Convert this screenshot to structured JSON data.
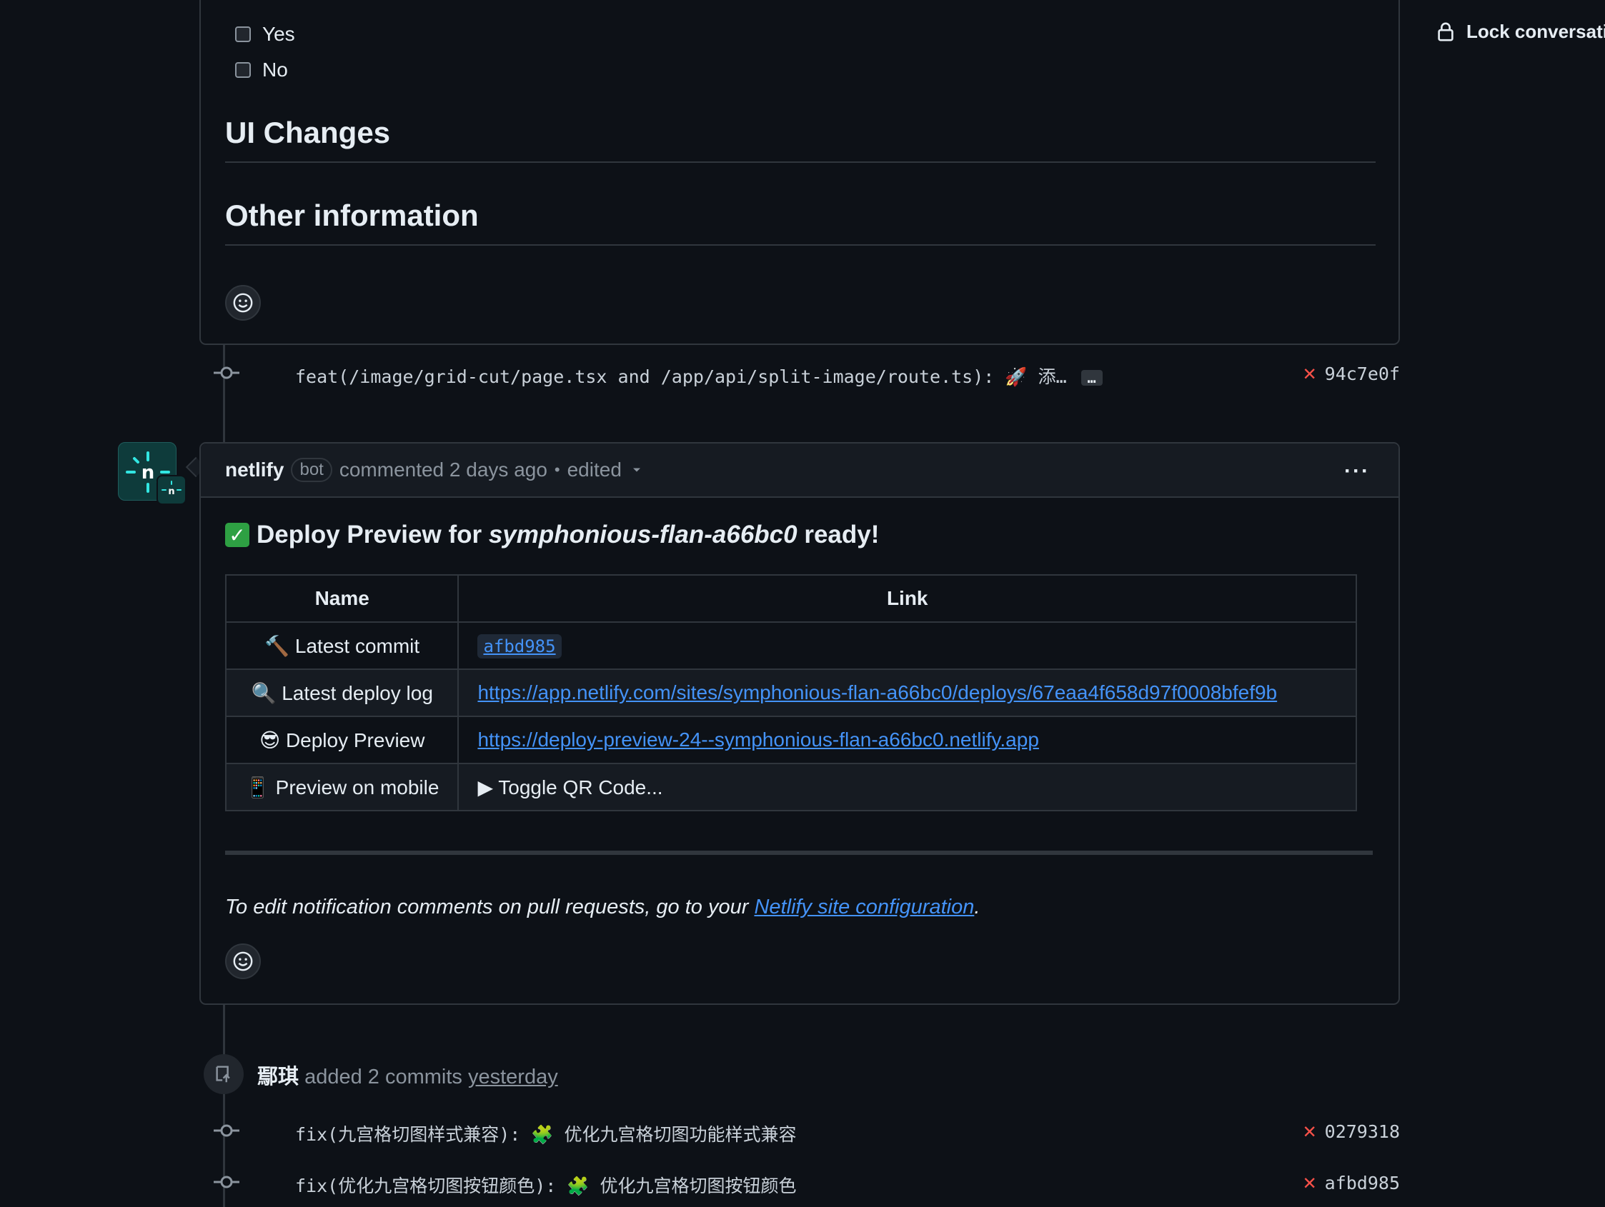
{
  "sidebar": {
    "lock_label": "Lock conversation"
  },
  "description": {
    "options": [
      "Yes",
      "No"
    ],
    "headings": [
      "UI Changes",
      "Other information"
    ]
  },
  "commits_top": [
    {
      "message": "feat(/image/grid-cut/page.tsx and /app/api/split-image/route.ts): 🚀 添…",
      "more": "…",
      "sha": "94c7e0f",
      "status": "failed"
    }
  ],
  "comment": {
    "author": "netlify",
    "badge": "bot",
    "action": "commented 2 days ago",
    "separator": "•",
    "edited": "edited",
    "menu": "···",
    "title_prefix": "Deploy Preview for",
    "title_site": "symphonious-flan-a66bc0",
    "title_suffix": "ready!",
    "table": {
      "headers": [
        "Name",
        "Link"
      ],
      "rows": [
        {
          "icon": "🔨",
          "name": "Latest commit",
          "link": "afbd985",
          "type": "sha"
        },
        {
          "icon": "🔍",
          "name": "Latest deploy log",
          "link": "https://app.netlify.com/sites/symphonious-flan-a66bc0/deploys/67eaa4f658d97f0008bfef9b",
          "type": "link"
        },
        {
          "icon": "😎",
          "name": "Deploy Preview",
          "link": "https://deploy-preview-24--symphonious-flan-a66bc0.netlify.app",
          "type": "link"
        },
        {
          "icon": "📱",
          "name": "Preview on mobile",
          "link": "▶ Toggle QR Code...",
          "type": "toggle"
        }
      ]
    },
    "note_prefix": "To edit notification comments on pull requests, go to your",
    "note_link": "Netlify site configuration",
    "note_suffix": "."
  },
  "event": {
    "author": "鄢琪",
    "action": "added 2 commits",
    "time": "yesterday"
  },
  "commits_bottom": [
    {
      "message": "fix(九宫格切图样式兼容): 🧩 优化九宫格切图功能样式兼容",
      "sha": "0279318",
      "status": "failed"
    },
    {
      "message": "fix(优化九宫格切图按钮颜色): 🧩 优化九宫格切图按钮颜色",
      "sha": "afbd985",
      "status": "failed"
    }
  ],
  "colors": {
    "accent": "#4493f8",
    "fail": "#f85149",
    "success": "#2ea043",
    "netlify": "#32e6e2"
  }
}
